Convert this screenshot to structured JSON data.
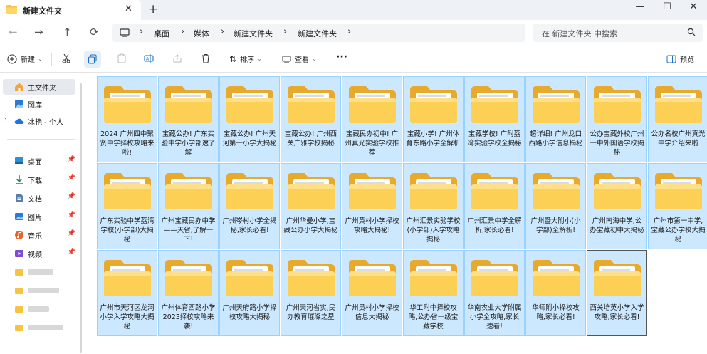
{
  "window": {
    "tab_title": "新建文件夹",
    "new_tab": "+",
    "minimize": "—",
    "maximize": "☐",
    "close": "✕",
    "tab_close": "✕"
  },
  "nav": {
    "back": "←",
    "forward": "→",
    "up": "↑",
    "refresh": "⟳",
    "sep": "›",
    "breadcrumb": [
      "桌面",
      "媒体",
      "新建文件夹",
      "新建文件夹"
    ],
    "search_placeholder": "在 新建文件夹 中搜索"
  },
  "toolbar": {
    "new_label": "新建",
    "sort_label": "排序",
    "view_label": "查看",
    "more_label": "···",
    "preview_label": "预览"
  },
  "sidebar": {
    "items": [
      {
        "label": "主文件夹",
        "icon": "home-icon"
      },
      {
        "label": "图库",
        "icon": "gallery-icon"
      },
      {
        "label": "冰艳 - 个人",
        "icon": "onedrive-cloud-icon"
      },
      {
        "label": "桌面",
        "icon": "desktop-icon"
      },
      {
        "label": "下载",
        "icon": "download-icon"
      },
      {
        "label": "文档",
        "icon": "document-icon"
      },
      {
        "label": "图片",
        "icon": "pictures-icon"
      },
      {
        "label": "音乐",
        "icon": "music-icon"
      },
      {
        "label": "视频",
        "icon": "video-icon"
      }
    ]
  },
  "folders": [
    "2024 广州四中聚贤中学择校攻略来啦!",
    "宝藏公办! 广东实验中学小学部速了解",
    "宝藏公办! 广州天河第一小学大揭秘",
    "宝藏公办! 广州西关广雅学校揭秘",
    "宝藏民办初中! 广州真光实验学校推荐",
    "宝藏小学! 广州体育东路小学全解析",
    "宝藏学校! 广附荔湾实验学校全揭秘",
    "超详细! 广州龙口西路小学信息揭秘",
    "公办宝藏外校广州一中外国语学校揭秘",
    "公办名校广州真光中学介绍来啦",
    "广东实验中学荔湾学校(小学部)大揭秘",
    "广州宝藏民办中学——天省,了解一下!",
    "广州岑村小学全揭秘,家长必看!",
    "广州华曼小学,宝藏公办小学大揭秘",
    "广州黄村小学择校攻略大揭秘!",
    "广州汇景实验学校(小学部)入学攻略揭秘",
    "广州汇景中学全解析,家长必看!",
    "广州暨大附小(小学部)全解析!",
    "广州南海中学,公办宝藏初中大揭秘",
    "广州市第一中学,宝藏公办学校大揭秘",
    "广州市天河区龙洞小学入学攻略大揭秘",
    "广州体育西路小学2023择校攻略来袭!",
    "广州天府路小学择校攻略大揭秘",
    "广州天河省实,民办教育璀璨之星",
    "广州员村小学择校信息大揭秘",
    "华工附中择校攻略,公办省一级宝藏学校",
    "华南农业大学附属小学全攻略,家长速看!",
    "华师附小择校攻略,家长必看!",
    "西关培英小学入学攻略,家长必看!"
  ],
  "colors": {
    "selection_fill": "#cce8ff",
    "selection_border": "#99d1ff",
    "folder_yellow": "#f6c343",
    "titlebar_bg": "#eef1f5"
  }
}
